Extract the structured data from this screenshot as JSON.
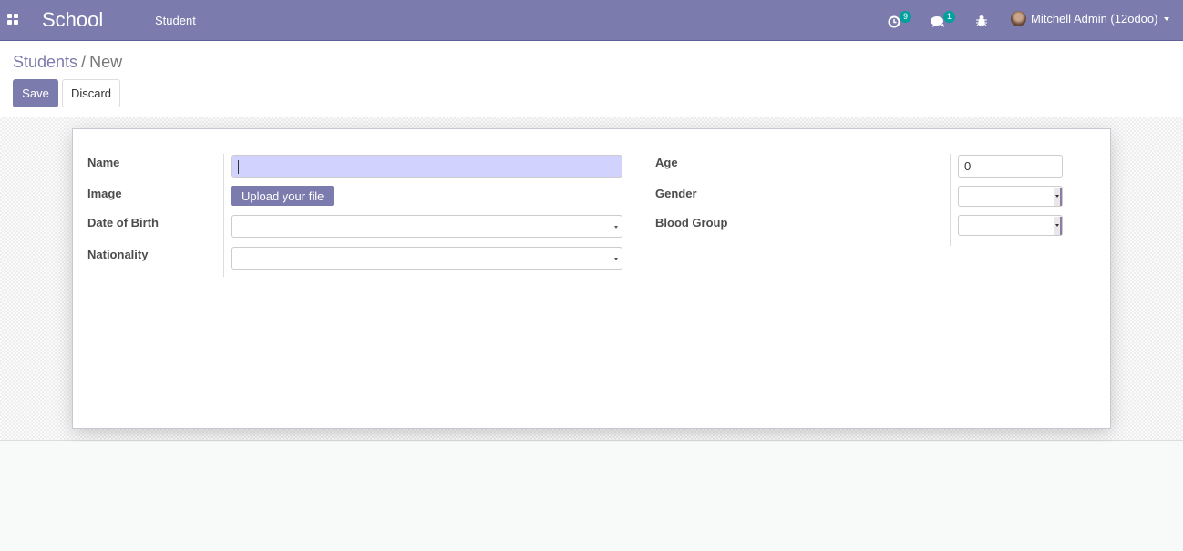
{
  "navbar": {
    "brand": "School",
    "menu_items": [
      {
        "label": "Student"
      }
    ],
    "systray": {
      "activity": {
        "icon": "clock-icon",
        "count": "9"
      },
      "messages": {
        "icon": "chat-icon",
        "count": "1"
      },
      "debug": {
        "icon": "bug-icon"
      },
      "user": {
        "name": "Mitchell Admin (12odoo)"
      }
    },
    "colors": {
      "primary": "#7c7bad",
      "badge": "#00a09d"
    }
  },
  "control_panel": {
    "breadcrumb": [
      {
        "label": "Students"
      },
      {
        "label": "New"
      }
    ],
    "separator": "/",
    "buttons": {
      "save": "Save",
      "discard": "Discard"
    }
  },
  "form": {
    "left": [
      {
        "label": "Name",
        "value": "",
        "type": "char",
        "focused": true
      },
      {
        "label": "Image",
        "button": "Upload your file",
        "type": "binary"
      },
      {
        "label": "Date of Birth",
        "value": "",
        "type": "date"
      },
      {
        "label": "Nationality",
        "value": "",
        "type": "many2one"
      }
    ],
    "right": [
      {
        "label": "Age",
        "value": "0",
        "type": "integer"
      },
      {
        "label": "Gender",
        "value": "",
        "type": "selection"
      },
      {
        "label": "Blood Group",
        "value": "",
        "type": "selection"
      }
    ]
  }
}
